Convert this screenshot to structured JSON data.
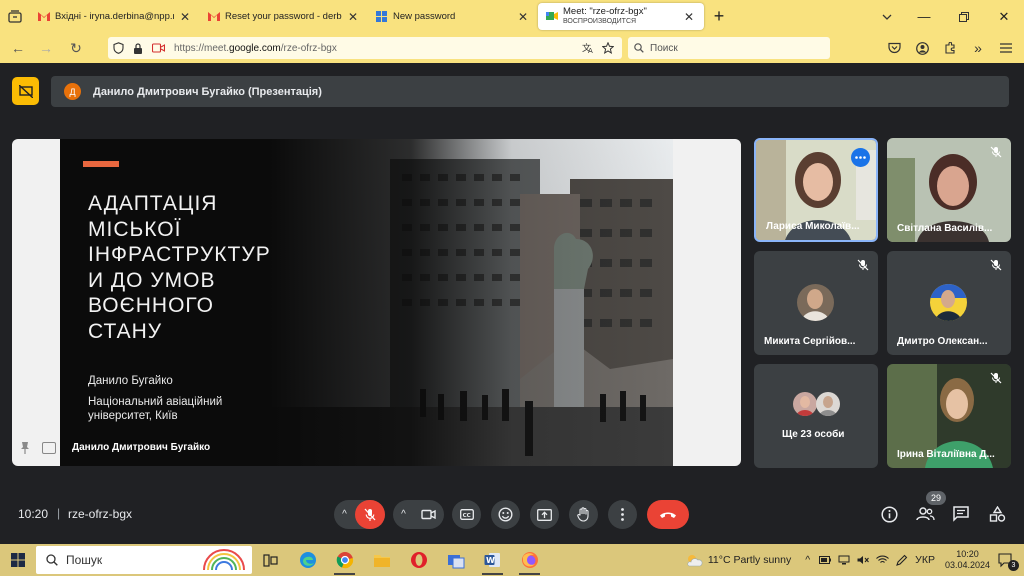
{
  "browser": {
    "tabs": [
      {
        "title": "Вхідні - iryna.derbina@npp.nau.",
        "icon": "gmail-icon"
      },
      {
        "title": "Reset your password - derbira9",
        "icon": "gmail-icon"
      },
      {
        "title": "New password",
        "icon": "windows-icon"
      },
      {
        "title": "Meet: \"rze-ofrz-bgx\"",
        "subtitle": "ВОСПРОИЗВОДИТСЯ",
        "icon": "meet-icon",
        "active": true
      }
    ],
    "url_prefix": "https://meet.",
    "url_domain": "google.com",
    "url_path": "/rze-ofrz-bgx",
    "search_placeholder": "Поиск"
  },
  "meet": {
    "presenter_initial": "Д",
    "presentation_title": "Данило Дмитрович Бугайко (Презентація)",
    "slide": {
      "headline": "АДАПТАЦІЯ\nМІСЬКОЇ\nІНФРАСТРУКТУР\nИ ДО УМОВ\nВОЄННОГО\nСТАНУ",
      "author": "Данило Бугайко",
      "organization": "Національний авіаційний університет, Київ"
    },
    "stage_name": "Данило Дмитрович Бугайко",
    "participants": [
      {
        "name": "Лариса Миколаїв...",
        "active_speaker": true
      },
      {
        "name": "Світлана Василів..."
      },
      {
        "name": "Микита Сергійов..."
      },
      {
        "name": "Дмитро Олексан..."
      },
      {
        "name": "Ще 23 особи"
      },
      {
        "name": "Ірина Віталіївна Д..."
      }
    ],
    "time": "10:20",
    "code": "rze-ofrz-bgx",
    "participant_count": "29"
  },
  "taskbar": {
    "search_label": "Пошук",
    "weather": "11°C  Partly sunny",
    "language": "УКР",
    "time": "10:20",
    "date": "03.04.2024",
    "notifications": "3"
  },
  "colors": {
    "browser_bar": "#f9e27f",
    "meet_bg": "#202124",
    "tile_bg": "#3c4043",
    "end_call": "#ea4335",
    "accent": "#e8673f",
    "present_badge": "#fbbc04"
  }
}
